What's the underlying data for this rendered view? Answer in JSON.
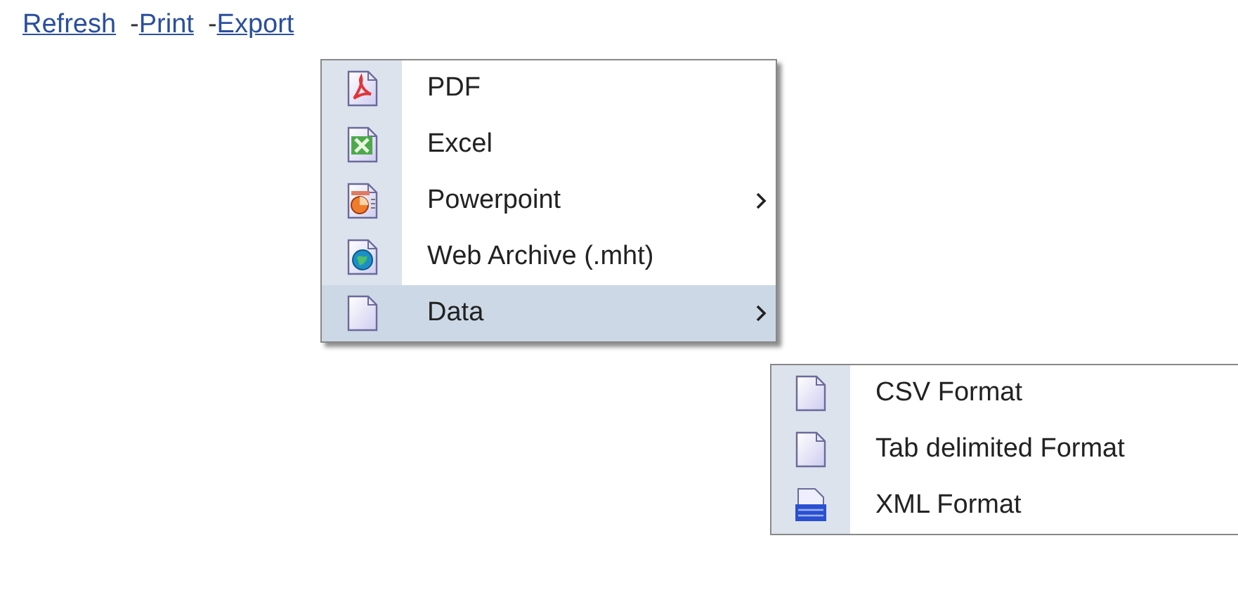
{
  "toolbar": [
    {
      "kind": "link",
      "text": "Refresh"
    },
    {
      "kind": "separator",
      "text": "-"
    },
    {
      "kind": "link",
      "text": "Print"
    },
    {
      "kind": "separator",
      "text": "-"
    },
    {
      "kind": "link",
      "text": "Export"
    }
  ],
  "export_menu": [
    {
      "kind": "pdf",
      "label": "PDF",
      "has_submenu": false,
      "selected": false
    },
    {
      "kind": "excel",
      "label": "Excel",
      "has_submenu": false,
      "selected": false
    },
    {
      "kind": "powerpoint",
      "label": "Powerpoint",
      "has_submenu": true,
      "selected": false
    },
    {
      "kind": "web",
      "label": "Web Archive (.mht)",
      "has_submenu": false,
      "selected": false
    },
    {
      "kind": "blank",
      "label": "Data",
      "has_submenu": true,
      "selected": true
    }
  ],
  "data_submenu": [
    {
      "kind": "blank",
      "label": "CSV Format",
      "has_submenu": false,
      "selected": false
    },
    {
      "kind": "blank",
      "label": "Tab delimited Format",
      "has_submenu": false,
      "selected": false
    },
    {
      "kind": "xml",
      "label": "XML Format",
      "has_submenu": false,
      "selected": false
    }
  ]
}
